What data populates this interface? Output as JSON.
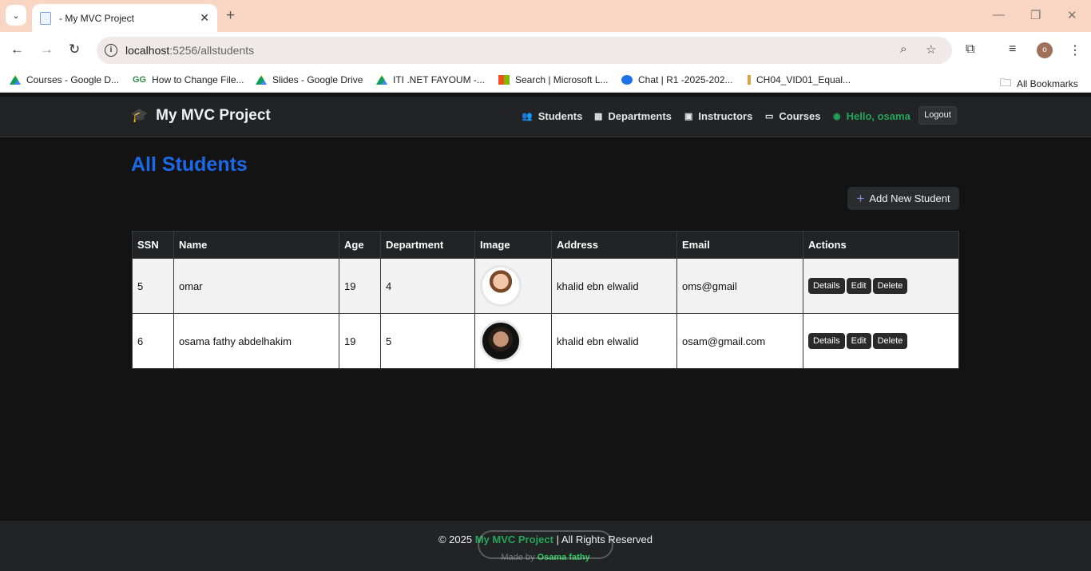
{
  "browser": {
    "tab_title": "- My MVC Project",
    "url_host": "localhost",
    "url_path": ":5256/allstudents",
    "profile_initial": "o",
    "bookmarks": [
      "Courses - Google D...",
      "How to Change File...",
      "Slides - Google Drive",
      "ITI .NET FAYOUM -...",
      "Search | Microsoft L...",
      "Chat | R1 -2025-202...",
      "CH04_VID01_Equal...",
      "All Bookmarks"
    ]
  },
  "site": {
    "brand": "My MVC Project",
    "nav": [
      {
        "label": "Students",
        "icon": "users-icon"
      },
      {
        "label": "Departments",
        "icon": "building-icon"
      },
      {
        "label": "Instructors",
        "icon": "id-card-icon"
      },
      {
        "label": "Courses",
        "icon": "book-icon"
      }
    ],
    "greeting": "Hello, osama",
    "logout": "Logout"
  },
  "main": {
    "title": "All Students",
    "add_button": "Add New Student",
    "columns": [
      "SSN",
      "Name",
      "Age",
      "Department",
      "Image",
      "Address",
      "Email",
      "Actions"
    ],
    "rows": [
      {
        "ssn": "5",
        "name": "omar",
        "age": "19",
        "department": "4",
        "address": "khalid ebn elwalid",
        "email": "oms@gmail"
      },
      {
        "ssn": "6",
        "name": "osama fathy abdelhakim",
        "age": "19",
        "department": "5",
        "address": "khalid ebn elwalid",
        "email": "osam@gmail.com"
      }
    ],
    "actions": [
      "Details",
      "Edit",
      "Delete"
    ]
  },
  "footer": {
    "copy_prefix": "© 2025",
    "project": "My MVC Project",
    "copy_suffix": "| All Rights Reserved",
    "made_by_prefix": "Made by",
    "author": "Osama fathy"
  },
  "colors": {
    "title_blue": "#1d68e6",
    "success_green": "#26a55a",
    "nav_bg": "#212325",
    "page_bg": "#131314"
  }
}
